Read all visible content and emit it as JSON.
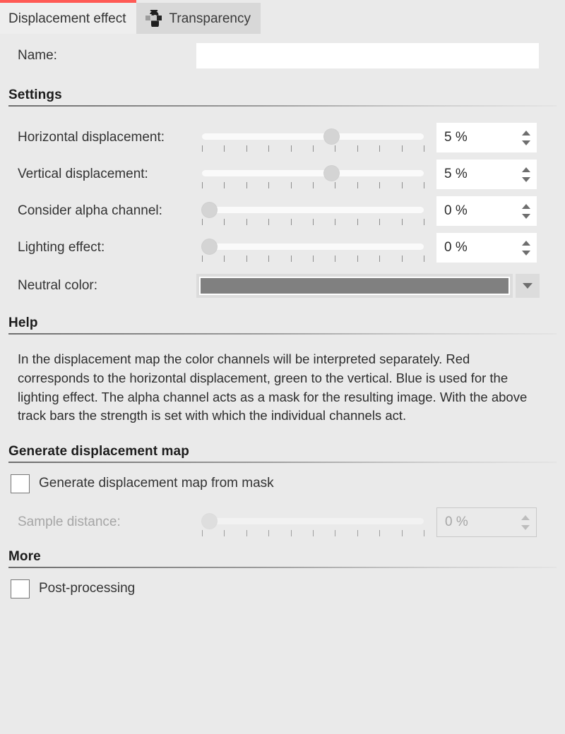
{
  "tabs": [
    {
      "label": "Displacement effect",
      "active": true,
      "icon": null
    },
    {
      "label": "Transparency",
      "active": false,
      "icon": "transparency-checkerboard-icon"
    }
  ],
  "accent_color": "#ff5a55",
  "background_color": "#eaeaea",
  "name_field": {
    "label": "Name:",
    "value": "",
    "placeholder": ""
  },
  "sections": {
    "settings": {
      "title": "Settings"
    },
    "help": {
      "title": "Help"
    },
    "generate": {
      "title": "Generate displacement map"
    },
    "more": {
      "title": "More"
    }
  },
  "sliders": [
    {
      "label": "Horizontal displacement:",
      "value": "5 %",
      "percent": 57,
      "enabled": true,
      "ticks": 11
    },
    {
      "label": "Vertical displacement:",
      "value": "5 %",
      "percent": 57,
      "enabled": true,
      "ticks": 11
    },
    {
      "label": "Consider alpha channel:",
      "value": "0 %",
      "percent": 0,
      "enabled": true,
      "ticks": 11
    },
    {
      "label": "Lighting effect:",
      "value": "0 %",
      "percent": 0,
      "enabled": true,
      "ticks": 11
    }
  ],
  "neutral_color": {
    "label": "Neutral color:",
    "swatch_color": "#808080",
    "dropdown_icon": "chevron-down-icon"
  },
  "help": {
    "text": "In the displacement map the color channels will be interpreted separately. Red corresponds to the horizontal displacement, green to the vertical. Blue is used for the lighting effect. The alpha channel acts as a mask for the resulting image. With the above track bars the strength is set with which the individual channels act."
  },
  "generate_map": {
    "checkbox_label": "Generate displacement map from mask",
    "checked": false,
    "sample_distance": {
      "label": "Sample distance:",
      "value": "0 %",
      "percent": 0,
      "enabled": false,
      "ticks": 11
    }
  },
  "more": {
    "checkbox_label": "Post-processing",
    "checked": false
  },
  "spinner_icons": {
    "up": "arrow-up-icon",
    "down": "arrow-down-icon"
  }
}
